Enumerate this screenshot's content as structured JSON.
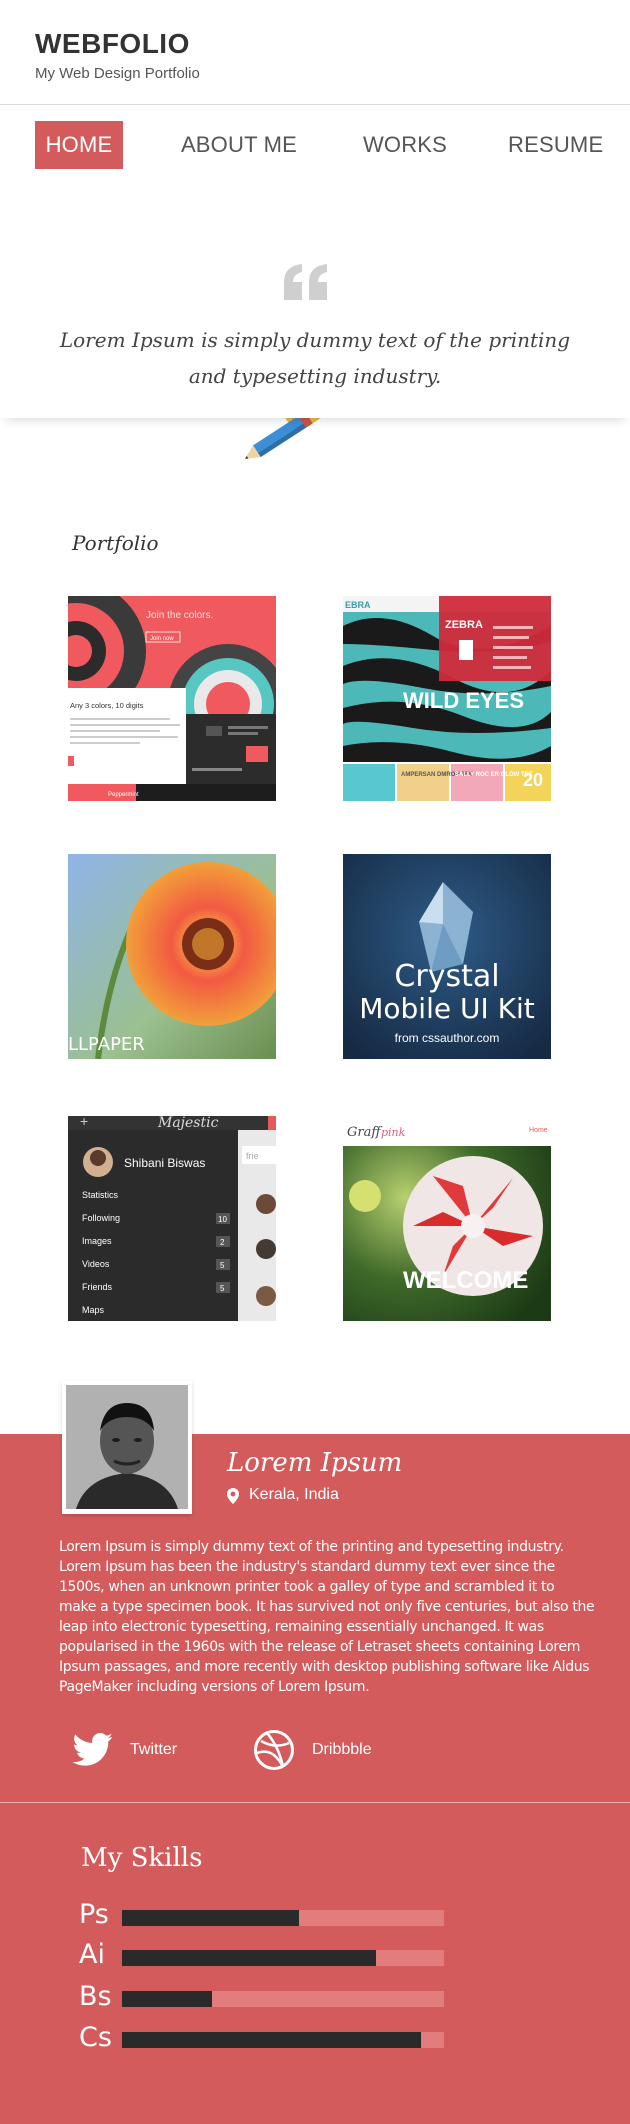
{
  "header": {
    "brand": "WEBFOLIO",
    "tagline": "My Web Design Portfolio"
  },
  "nav": {
    "items": [
      {
        "label": "HOME",
        "active": true
      },
      {
        "label": "ABOUT ME",
        "active": false
      },
      {
        "label": "WORKS",
        "active": false
      },
      {
        "label": "RESUME",
        "active": false
      }
    ]
  },
  "quote": {
    "text": "Lorem Ipsum is simply dummy text of the printing and typesetting industry."
  },
  "portfolio": {
    "title": "Portfolio",
    "items": [
      {
        "name": "join-the-colors",
        "texts": [
          "Join the colors.",
          "Join now",
          "Any 3 colors, 10 digits",
          "Peppermint"
        ]
      },
      {
        "name": "zebra",
        "texts": [
          "ZEBRA",
          "WILD EYES",
          "AMPERSAN DMROH TEE",
          "SALLY ROC ER GLOW TEE",
          "20"
        ]
      },
      {
        "name": "flower-wallpaper",
        "texts": [
          "LLPAPER"
        ]
      },
      {
        "name": "crystal-mobile-ui-kit",
        "texts": [
          "Crystal",
          "Mobile UI Kit",
          "from cssauthor.com"
        ]
      },
      {
        "name": "majestic-app",
        "texts": [
          "Majestic",
          "Shibani Biswas",
          "Statistics",
          "Following",
          "10",
          "Images",
          "2",
          "Videos",
          "5",
          "Friends",
          "5",
          "Maps"
        ]
      },
      {
        "name": "graffpink",
        "texts": [
          "Graff",
          "pink",
          "Home",
          "WELCOME"
        ]
      }
    ]
  },
  "profile": {
    "name": "Lorem Ipsum",
    "location": "Kerala, India",
    "bio": "Lorem Ipsum is simply dummy text of the printing and typesetting industry. Lorem Ipsum has been the industry's standard dummy text ever since the 1500s, when an unknown printer took a galley of type and scrambled it to make a type specimen book. It has survived not only five centuries, but also the leap into electronic typesetting, remaining essentially unchanged. It was popularised in the 1960s with the release of Letraset sheets containing Lorem Ipsum passages, and more recently with desktop publishing software like Aldus PageMaker including versions of Lorem Ipsum.",
    "social": [
      {
        "label": "Twitter",
        "icon": "twitter-icon"
      },
      {
        "label": "Dribbble",
        "icon": "dribbble-icon"
      }
    ]
  },
  "skills": {
    "title": "My Skills",
    "items": [
      {
        "name": "Ps",
        "level": 0.55
      },
      {
        "name": "Ai",
        "level": 0.79
      },
      {
        "name": "Bs",
        "level": 0.28
      },
      {
        "name": "Cs",
        "level": 0.93
      }
    ]
  },
  "colors": {
    "accent": "#d35b5b",
    "text_dark": "#333333",
    "skill_fill": "#2a2a2a",
    "skill_track": "#e37d7d"
  }
}
